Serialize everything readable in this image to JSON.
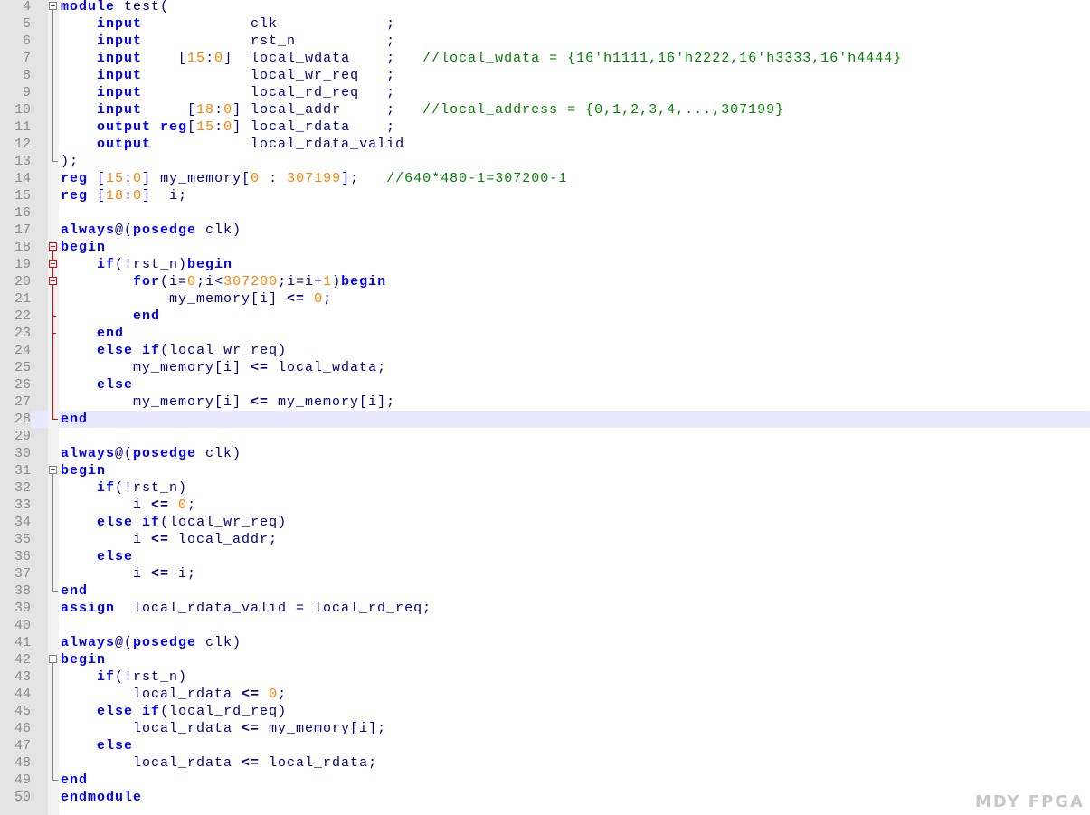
{
  "editor": {
    "current_line": 28,
    "colors": {
      "keyword": "#0000ff",
      "number": "#ff8000",
      "comment": "#008000",
      "text": "#000080",
      "current_line_bg": "#e8e8ff"
    },
    "lines": [
      {
        "n": 4,
        "tokens": [
          [
            "k",
            "module"
          ],
          [
            "t",
            " test("
          ]
        ]
      },
      {
        "n": 5,
        "tokens": [
          [
            "t",
            "    "
          ],
          [
            "k",
            "input"
          ],
          [
            "t",
            "            clk            ;"
          ]
        ]
      },
      {
        "n": 6,
        "tokens": [
          [
            "t",
            "    "
          ],
          [
            "k",
            "input"
          ],
          [
            "t",
            "            rst_n          ;"
          ]
        ]
      },
      {
        "n": 7,
        "tokens": [
          [
            "t",
            "    "
          ],
          [
            "k",
            "input"
          ],
          [
            "t",
            "    ["
          ],
          [
            "n",
            "15"
          ],
          [
            "t",
            ":"
          ],
          [
            "n",
            "0"
          ],
          [
            "t",
            "]  local_wdata    ;   "
          ],
          [
            "c",
            "//local_wdata = {16'h1111,16'h2222,16'h3333,16'h4444}"
          ]
        ]
      },
      {
        "n": 8,
        "tokens": [
          [
            "t",
            "    "
          ],
          [
            "k",
            "input"
          ],
          [
            "t",
            "            local_wr_req   ;"
          ]
        ]
      },
      {
        "n": 9,
        "tokens": [
          [
            "t",
            "    "
          ],
          [
            "k",
            "input"
          ],
          [
            "t",
            "            local_rd_req   ;"
          ]
        ]
      },
      {
        "n": 10,
        "tokens": [
          [
            "t",
            "    "
          ],
          [
            "k",
            "input"
          ],
          [
            "t",
            "     ["
          ],
          [
            "n",
            "18"
          ],
          [
            "t",
            ":"
          ],
          [
            "n",
            "0"
          ],
          [
            "t",
            "] local_addr     ;   "
          ],
          [
            "c",
            "//local_address = {0,1,2,3,4,...,307199}"
          ]
        ]
      },
      {
        "n": 11,
        "tokens": [
          [
            "t",
            "    "
          ],
          [
            "k",
            "output"
          ],
          [
            "t",
            " "
          ],
          [
            "k",
            "reg"
          ],
          [
            "t",
            "["
          ],
          [
            "n",
            "15"
          ],
          [
            "t",
            ":"
          ],
          [
            "n",
            "0"
          ],
          [
            "t",
            "] local_rdata    ;"
          ]
        ]
      },
      {
        "n": 12,
        "tokens": [
          [
            "t",
            "    "
          ],
          [
            "k",
            "output"
          ],
          [
            "t",
            "           local_rdata_valid"
          ]
        ]
      },
      {
        "n": 13,
        "tokens": [
          [
            "t",
            ");"
          ]
        ]
      },
      {
        "n": 14,
        "tokens": [
          [
            "k",
            "reg"
          ],
          [
            "t",
            " ["
          ],
          [
            "n",
            "15"
          ],
          [
            "t",
            ":"
          ],
          [
            "n",
            "0"
          ],
          [
            "t",
            "] my_memory["
          ],
          [
            "n",
            "0"
          ],
          [
            "t",
            " : "
          ],
          [
            "n",
            "307199"
          ],
          [
            "t",
            "];   "
          ],
          [
            "c",
            "//640*480-1=307200-1"
          ]
        ]
      },
      {
        "n": 15,
        "tokens": [
          [
            "k",
            "reg"
          ],
          [
            "t",
            " ["
          ],
          [
            "n",
            "18"
          ],
          [
            "t",
            ":"
          ],
          [
            "n",
            "0"
          ],
          [
            "t",
            "]  i;"
          ]
        ]
      },
      {
        "n": 16,
        "tokens": []
      },
      {
        "n": 17,
        "tokens": [
          [
            "k",
            "always"
          ],
          [
            "t",
            "@("
          ],
          [
            "k",
            "posedge"
          ],
          [
            "t",
            " clk)"
          ]
        ]
      },
      {
        "n": 18,
        "tokens": [
          [
            "k",
            "begin"
          ]
        ]
      },
      {
        "n": 19,
        "tokens": [
          [
            "t",
            "    "
          ],
          [
            "k",
            "if"
          ],
          [
            "t",
            "(!rst_n)"
          ],
          [
            "k",
            "begin"
          ]
        ]
      },
      {
        "n": 20,
        "tokens": [
          [
            "t",
            "        "
          ],
          [
            "k",
            "for"
          ],
          [
            "t",
            "(i="
          ],
          [
            "n",
            "0"
          ],
          [
            "t",
            ";i<"
          ],
          [
            "n",
            "307200"
          ],
          [
            "t",
            ";i=i+"
          ],
          [
            "n",
            "1"
          ],
          [
            "t",
            ")"
          ],
          [
            "k",
            "begin"
          ]
        ]
      },
      {
        "n": 21,
        "tokens": [
          [
            "t",
            "            my_memory[i] "
          ],
          [
            "o",
            "<="
          ],
          [
            "t",
            " "
          ],
          [
            "n",
            "0"
          ],
          [
            "t",
            ";"
          ]
        ]
      },
      {
        "n": 22,
        "tokens": [
          [
            "t",
            "        "
          ],
          [
            "k",
            "end"
          ]
        ]
      },
      {
        "n": 23,
        "tokens": [
          [
            "t",
            "    "
          ],
          [
            "k",
            "end"
          ]
        ]
      },
      {
        "n": 24,
        "tokens": [
          [
            "t",
            "    "
          ],
          [
            "k",
            "else"
          ],
          [
            "t",
            " "
          ],
          [
            "k",
            "if"
          ],
          [
            "t",
            "(local_wr_req)"
          ]
        ]
      },
      {
        "n": 25,
        "tokens": [
          [
            "t",
            "        my_memory[i] "
          ],
          [
            "o",
            "<="
          ],
          [
            "t",
            " local_wdata;"
          ]
        ]
      },
      {
        "n": 26,
        "tokens": [
          [
            "t",
            "    "
          ],
          [
            "k",
            "else"
          ]
        ]
      },
      {
        "n": 27,
        "tokens": [
          [
            "t",
            "        my_memory[i] "
          ],
          [
            "o",
            "<="
          ],
          [
            "t",
            " my_memory[i];"
          ]
        ]
      },
      {
        "n": 28,
        "tokens": [
          [
            "k",
            "end"
          ]
        ]
      },
      {
        "n": 29,
        "tokens": []
      },
      {
        "n": 30,
        "tokens": [
          [
            "k",
            "always"
          ],
          [
            "t",
            "@("
          ],
          [
            "k",
            "posedge"
          ],
          [
            "t",
            " clk)"
          ]
        ]
      },
      {
        "n": 31,
        "tokens": [
          [
            "k",
            "begin"
          ]
        ]
      },
      {
        "n": 32,
        "tokens": [
          [
            "t",
            "    "
          ],
          [
            "k",
            "if"
          ],
          [
            "t",
            "(!rst_n)"
          ]
        ]
      },
      {
        "n": 33,
        "tokens": [
          [
            "t",
            "        i "
          ],
          [
            "o",
            "<="
          ],
          [
            "t",
            " "
          ],
          [
            "n",
            "0"
          ],
          [
            "t",
            ";"
          ]
        ]
      },
      {
        "n": 34,
        "tokens": [
          [
            "t",
            "    "
          ],
          [
            "k",
            "else"
          ],
          [
            "t",
            " "
          ],
          [
            "k",
            "if"
          ],
          [
            "t",
            "(local_wr_req)"
          ]
        ]
      },
      {
        "n": 35,
        "tokens": [
          [
            "t",
            "        i "
          ],
          [
            "o",
            "<="
          ],
          [
            "t",
            " local_addr;"
          ]
        ]
      },
      {
        "n": 36,
        "tokens": [
          [
            "t",
            "    "
          ],
          [
            "k",
            "else"
          ]
        ]
      },
      {
        "n": 37,
        "tokens": [
          [
            "t",
            "        i "
          ],
          [
            "o",
            "<="
          ],
          [
            "t",
            " i;"
          ]
        ]
      },
      {
        "n": 38,
        "tokens": [
          [
            "k",
            "end"
          ]
        ]
      },
      {
        "n": 39,
        "tokens": [
          [
            "k",
            "assign"
          ],
          [
            "t",
            "  local_rdata_valid = local_rd_req;"
          ]
        ]
      },
      {
        "n": 40,
        "tokens": []
      },
      {
        "n": 41,
        "tokens": [
          [
            "k",
            "always"
          ],
          [
            "t",
            "@("
          ],
          [
            "k",
            "posedge"
          ],
          [
            "t",
            " clk)"
          ]
        ]
      },
      {
        "n": 42,
        "tokens": [
          [
            "k",
            "begin"
          ]
        ]
      },
      {
        "n": 43,
        "tokens": [
          [
            "t",
            "    "
          ],
          [
            "k",
            "if"
          ],
          [
            "t",
            "(!rst_n)"
          ]
        ]
      },
      {
        "n": 44,
        "tokens": [
          [
            "t",
            "        local_rdata "
          ],
          [
            "o",
            "<="
          ],
          [
            "t",
            " "
          ],
          [
            "n",
            "0"
          ],
          [
            "t",
            ";"
          ]
        ]
      },
      {
        "n": 45,
        "tokens": [
          [
            "t",
            "    "
          ],
          [
            "k",
            "else"
          ],
          [
            "t",
            " "
          ],
          [
            "k",
            "if"
          ],
          [
            "t",
            "(local_rd_req)"
          ]
        ]
      },
      {
        "n": 46,
        "tokens": [
          [
            "t",
            "        local_rdata "
          ],
          [
            "o",
            "<="
          ],
          [
            "t",
            " my_memory[i];"
          ]
        ]
      },
      {
        "n": 47,
        "tokens": [
          [
            "t",
            "    "
          ],
          [
            "k",
            "else"
          ]
        ]
      },
      {
        "n": 48,
        "tokens": [
          [
            "t",
            "        local_rdata "
          ],
          [
            "o",
            "<="
          ],
          [
            "t",
            " local_rdata;"
          ]
        ]
      },
      {
        "n": 49,
        "tokens": [
          [
            "k",
            "end"
          ]
        ]
      },
      {
        "n": 50,
        "tokens": [
          [
            "k",
            "endmodule"
          ]
        ]
      }
    ]
  },
  "watermark": {
    "text": "MDY FPGA"
  }
}
